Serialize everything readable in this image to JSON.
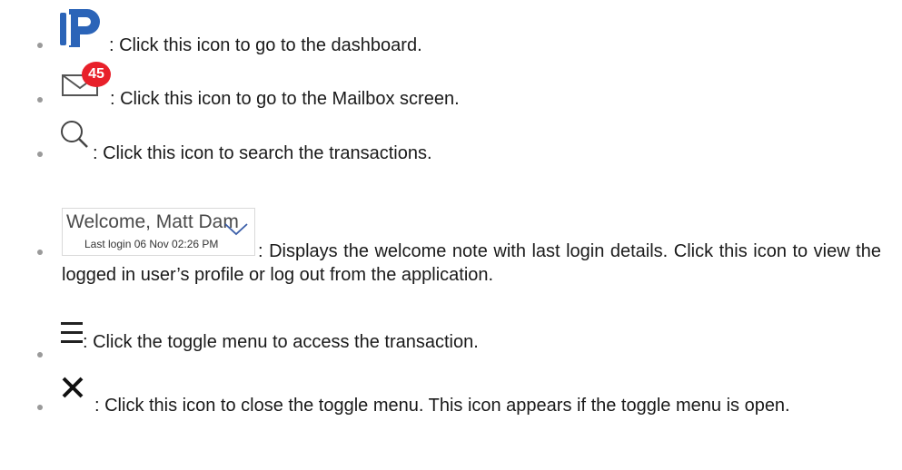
{
  "items": [
    {
      "icon": "logo-icon",
      "text": ": Click this icon to go to the dashboard."
    },
    {
      "icon": "mail-icon",
      "badge_count": "45",
      "text": ": Click this icon to go to the Mailbox screen."
    },
    {
      "icon": "search-icon",
      "text": ": Click this icon to search the transactions."
    },
    {
      "icon": "welcome-widget",
      "welcome_text": "Welcome, Matt Dam",
      "last_login": "Last login 06 Nov 02:26 PM",
      "text": ": Displays the welcome note with last login details. Click this icon to view the logged in user’s profile or log out from the application."
    },
    {
      "icon": "hamburger-menu-icon",
      "text": ": Click the toggle menu to access the transaction."
    },
    {
      "icon": "close-icon",
      "text": ": Click this icon to close the toggle menu. This icon appears if the toggle menu is open."
    }
  ],
  "colors": {
    "logo_blue": "#2b64b8",
    "badge_red": "#e8202a",
    "text": "#1a1a1a",
    "bullet": "#9a9a9a"
  }
}
